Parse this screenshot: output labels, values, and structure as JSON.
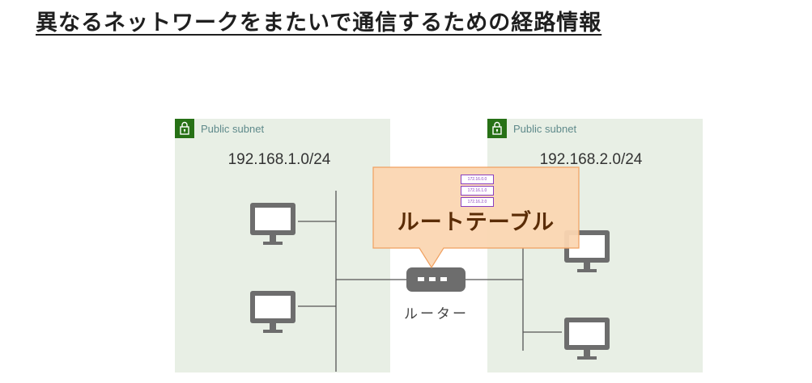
{
  "title": "異なるネットワークをまたいで通信するための経路情報",
  "subnets": [
    {
      "label": "Public subnet",
      "cidr": "192.168.1.0/24"
    },
    {
      "label": "Public subnet",
      "cidr": "192.168.2.0/24"
    }
  ],
  "route_table": {
    "label": "ルートテーブル",
    "entries": [
      "172.16.0.0",
      "172.16.1.0",
      "172.16.2.0"
    ]
  },
  "router": {
    "label": "ルーター"
  },
  "colors": {
    "subnet_bg": "#e8efe5",
    "lock": "#277116",
    "callout_fill": "#fbd6b2",
    "callout_stroke": "#f0a060",
    "router": "#6d6d6d",
    "route_entry": "#8a3fbf"
  }
}
